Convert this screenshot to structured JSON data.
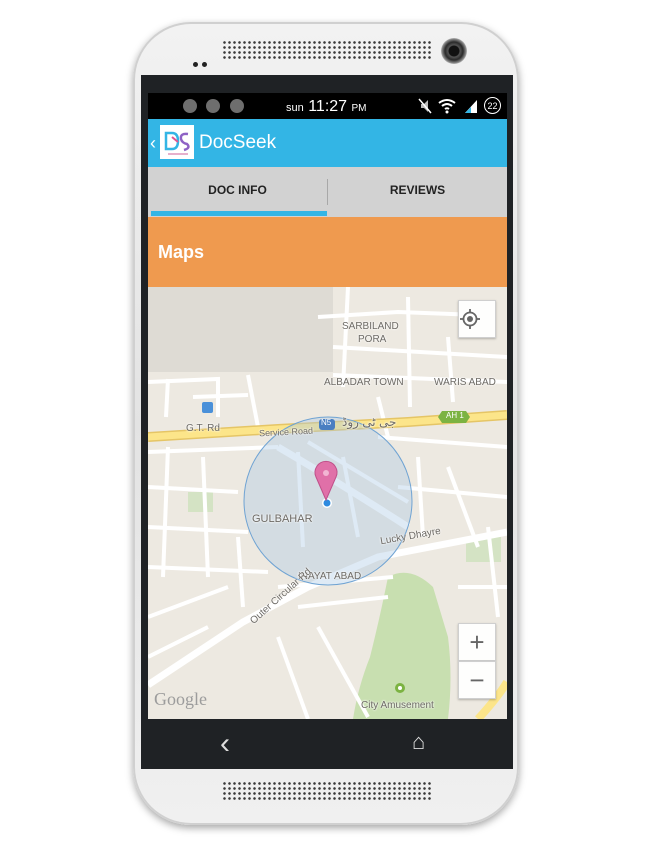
{
  "status_bar": {
    "day": "sun",
    "time": "11:27",
    "ampm": "PM",
    "badge": "22"
  },
  "app_bar": {
    "title": "DocSeek"
  },
  "tabs": [
    {
      "label": "DOC INFO"
    },
    {
      "label": "REVIEWS"
    }
  ],
  "section": {
    "title": "Maps"
  },
  "map": {
    "labels": {
      "sarbiland": "SARBILAND",
      "pora": "PORA",
      "albadar": "ALBADAR TOWN",
      "waris": "WARIS ABAD",
      "gt_rd": "G.T. Rd",
      "service_road": "Service Road",
      "n5": "N5",
      "urdu": "جی ٹی روڈ",
      "ah1": "AH 1",
      "gulbahar": "GULBAHAR",
      "lucky": "Lucky Dhayre",
      "inayat": "INAYAT ABAD",
      "outer_circular": "Outer Circular Rd",
      "city_amusement": "City Amusement",
      "google": "Google"
    },
    "zoom_in": "+",
    "zoom_out": "−"
  },
  "nav": {
    "back": "‹",
    "home": "⌂"
  }
}
